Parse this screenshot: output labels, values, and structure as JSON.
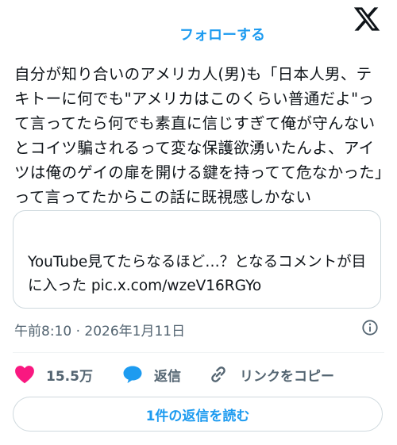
{
  "header": {
    "follow_label": "フォローする",
    "logo_icon": "x-logo-icon"
  },
  "tweet": {
    "text": "自分が知り合いのアメリカ人(男)も「日本人男、テキトーに何でも\"アメリカはこのくらい普通だよ\"って言ってたら何でも素直に信じすぎて俺が守んないとコイツ騙されるって変な保護欲湧いたんよ、アイツは俺のゲイの扉を開ける鍵を持ってて危なかった」って言ってたからこの話に既視感しかない",
    "quote_text": "YouTube見てたらなるほど…？となるコメントが目に入った pic.x.com/wzeV16RGYo",
    "timestamp": "午前8:10 · 2026年1月11日"
  },
  "actions": {
    "like_count": "15.5万",
    "reply_label": "返信",
    "copy_link_label": "リンクをコピー"
  },
  "read_replies_label": "1件の返信を読む",
  "colors": {
    "accent": "#1d9bf0",
    "like": "#f91880",
    "text_secondary": "#536471",
    "border": "#cfd9de"
  }
}
